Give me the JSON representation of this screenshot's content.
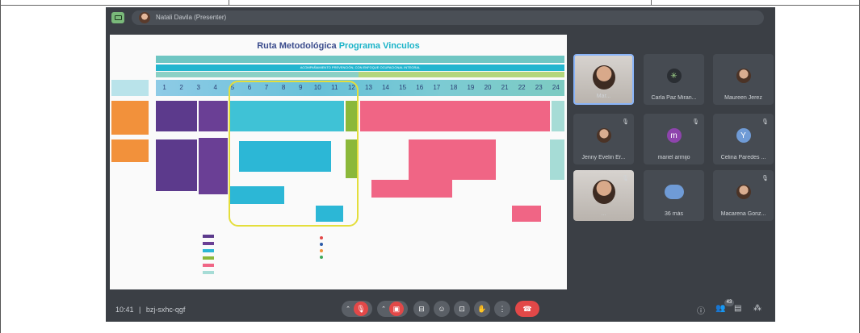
{
  "meeting": {
    "presenter_label": "Natali Davila (Presenter)",
    "time": "10:41",
    "code": "bzj-sxhc-qgf",
    "separator": "|"
  },
  "slide": {
    "title_main": "Ruta Metodológica",
    "title_accent": "Programa Vinculos",
    "header_band": "ACOMPAÑAMIENTO PREVENCIÓN, CON ENFOQUE OCUPACIONAL INTEGRAL",
    "months": [
      "1",
      "2",
      "3",
      "4",
      "5",
      "6",
      "7",
      "8",
      "9",
      "10",
      "11",
      "12",
      "13",
      "14",
      "15",
      "16",
      "17",
      "18",
      "19",
      "20",
      "21",
      "22",
      "23",
      "24"
    ]
  },
  "participants": [
    {
      "name": "Mar...",
      "type": "video",
      "highlight": true
    },
    {
      "name": "Carla Paz Miran...",
      "type": "logo"
    },
    {
      "name": "Maureen Jerez",
      "type": "photo"
    },
    {
      "name": "Jenny Evelin Er...",
      "type": "photo",
      "muted": true
    },
    {
      "name": "mariel armijo",
      "type": "letter",
      "letter": "m",
      "color": "#8e44ad",
      "muted": true
    },
    {
      "name": "Celina Paredes ...",
      "type": "letter",
      "letter": "Y",
      "color": "#6f9bd6",
      "muted": true
    },
    {
      "name": "...",
      "type": "video",
      "muted": true
    },
    {
      "name": "36 más",
      "type": "more"
    },
    {
      "name": "Macarena Gonz...",
      "type": "photo",
      "muted": true
    }
  ],
  "controls": {
    "raise_hand_count": "43",
    "mic_icon": "mic-off-icon",
    "cam_icon": "camera-off-icon"
  },
  "colors": {
    "meet_bg": "#3b3f45",
    "end_call": "#e24848",
    "highlight_border": "#8ab4f8"
  }
}
